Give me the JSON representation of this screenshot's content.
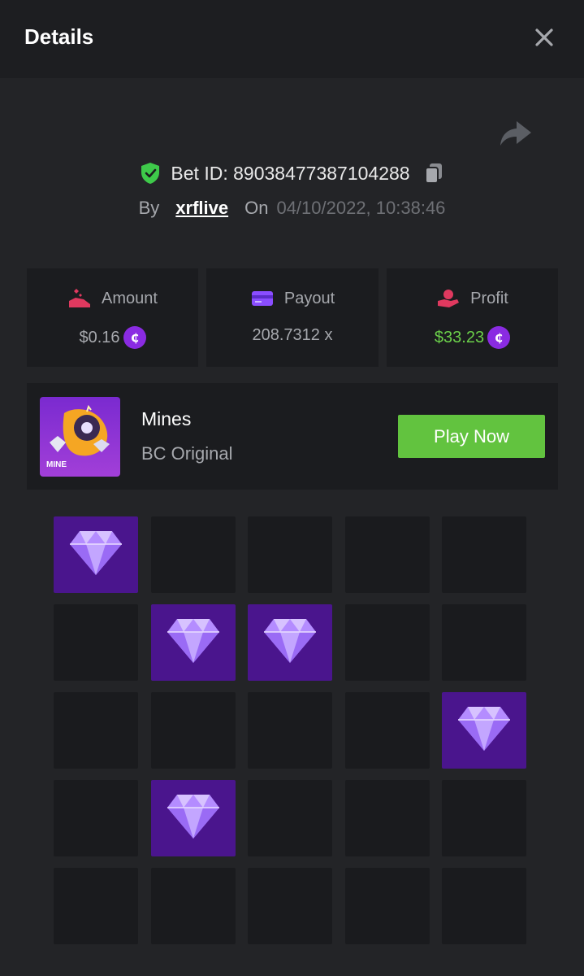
{
  "header": {
    "title": "Details"
  },
  "bet": {
    "id_label": "Bet ID: 89038477387104288",
    "by_label": "By",
    "username": "xrflive",
    "on_label": "On",
    "datetime": "04/10/2022, 10:38:46"
  },
  "stats": [
    {
      "label": "Amount",
      "value": "$0.16",
      "icon": "money-hand-icon",
      "coin": true
    },
    {
      "label": "Payout",
      "value": "208.7312 x",
      "icon": "card-icon",
      "coin": false
    },
    {
      "label": "Profit",
      "value": "$33.23",
      "icon": "profit-hand-icon",
      "coin": true
    }
  ],
  "game": {
    "name": "Mines",
    "subtitle": "BC Original",
    "thumb_label": "MINE",
    "play_label": "Play Now"
  },
  "grid": {
    "rows": 5,
    "cols": 5,
    "gems": [
      [
        0,
        0
      ],
      [
        1,
        1
      ],
      [
        1,
        2
      ],
      [
        2,
        4
      ],
      [
        3,
        1
      ]
    ]
  },
  "colors": {
    "accent_green": "#62c33f",
    "gem_bg": "#4a158d",
    "coin": "#8a2be2",
    "shield": "#3ec94a"
  }
}
